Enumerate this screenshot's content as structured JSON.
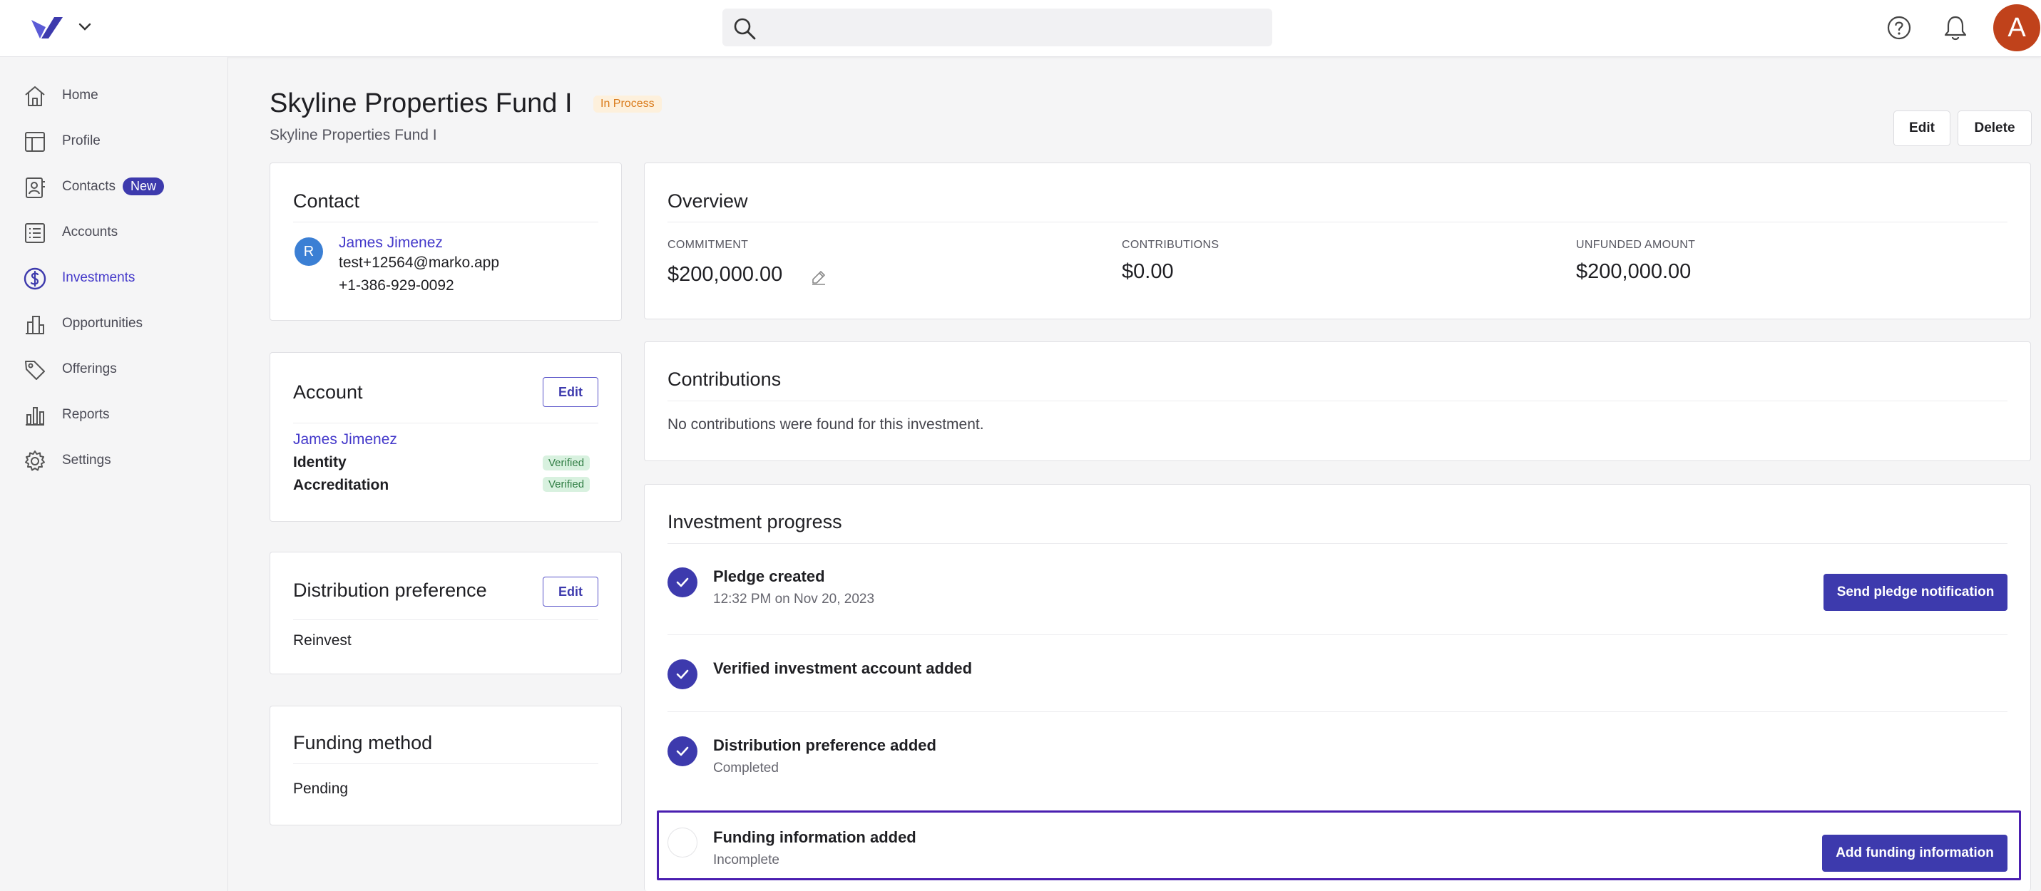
{
  "header": {
    "search_placeholder": "",
    "avatar_initial": "A"
  },
  "sidebar": {
    "items": [
      {
        "label": "Home",
        "icon": "home-icon"
      },
      {
        "label": "Profile",
        "icon": "profile-icon"
      },
      {
        "label": "Contacts",
        "icon": "contacts-icon",
        "badge": "New"
      },
      {
        "label": "Accounts",
        "icon": "accounts-icon"
      },
      {
        "label": "Investments",
        "icon": "investments-icon",
        "active": true
      },
      {
        "label": "Opportunities",
        "icon": "opportunities-icon"
      },
      {
        "label": "Offerings",
        "icon": "offerings-icon"
      },
      {
        "label": "Reports",
        "icon": "reports-icon"
      },
      {
        "label": "Settings",
        "icon": "settings-icon"
      }
    ]
  },
  "page": {
    "title": "Skyline Properties Fund I",
    "status": "In Process",
    "subtitle": "Skyline Properties Fund I",
    "edit_label": "Edit",
    "delete_label": "Delete"
  },
  "contact": {
    "title": "Contact",
    "avatar_initial": "R",
    "name": "James Jimenez",
    "email": "test+12564@marko.app",
    "phone": "+1-386-929-0092"
  },
  "account": {
    "title": "Account",
    "edit_label": "Edit",
    "name": "James Jimenez",
    "identity_label": "Identity",
    "identity_status": "Verified",
    "accreditation_label": "Accreditation",
    "accreditation_status": "Verified"
  },
  "distribution": {
    "title": "Distribution preference",
    "edit_label": "Edit",
    "value": "Reinvest"
  },
  "funding": {
    "title": "Funding method",
    "value": "Pending"
  },
  "overview": {
    "title": "Overview",
    "commitment_label": "COMMITMENT",
    "commitment_value": "$200,000.00",
    "contributions_label": "CONTRIBUTIONS",
    "contributions_value": "$0.00",
    "unfunded_label": "UNFUNDED AMOUNT",
    "unfunded_value": "$200,000.00"
  },
  "contributions": {
    "title": "Contributions",
    "empty_text": "No contributions were found for this investment."
  },
  "progress": {
    "title": "Investment progress",
    "steps": [
      {
        "title": "Pledge created",
        "subtitle": "12:32 PM on Nov 20, 2023",
        "done": true,
        "action": "Send pledge notification"
      },
      {
        "title": "Verified investment account added",
        "subtitle": "",
        "done": true
      },
      {
        "title": "Distribution preference added",
        "subtitle": "Completed",
        "done": true
      },
      {
        "title": "Funding information added",
        "subtitle": "Incomplete",
        "done": false,
        "action": "Add funding information"
      }
    ]
  },
  "colors": {
    "primary": "#3d3aad",
    "accent_link": "#4338ca",
    "status_badge_bg": "#fdf0dc",
    "status_badge_text": "#d97a1a",
    "verified_bg": "#d8f1df",
    "verified_text": "#2f7d43",
    "avatar_top": "#c0421b",
    "contact_avatar": "#3b7fd4",
    "highlight_border": "#4a1fb0"
  }
}
